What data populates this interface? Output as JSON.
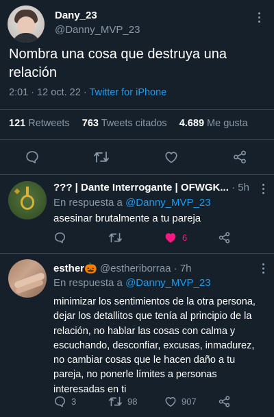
{
  "main_tweet": {
    "display_name": "Dany_23",
    "handle": "@Danny_MVP_23",
    "text": "Nombra una cosa que destruya una relación",
    "time": "2:01 · 12 oct. 22 · ",
    "source": "Twitter for iPhone",
    "stats": {
      "retweets_count": "121",
      "retweets_label": "Retweets",
      "quotes_count": "763",
      "quotes_label": "Tweets citados",
      "likes_count": "4.689",
      "likes_label": "Me gusta"
    }
  },
  "replies": [
    {
      "display_name": "??? | Dante Interrogante | OFWGK...",
      "meta": "· 5h",
      "reply_to_label": "En respuesta a ",
      "reply_to_handle": "@Danny_MVP_23",
      "text": "asesinar brutalmente a tu pareja",
      "actions": {
        "replies": "",
        "retweets": "",
        "likes": "6"
      },
      "liked": true
    },
    {
      "display_name": "esther🎃",
      "meta": "@estheriborraa · 7h",
      "reply_to_label": "En respuesta a ",
      "reply_to_handle": "@Danny_MVP_23",
      "text_lines": [
        "minimizar los sentimientos de la otra persona,",
        "dejar los detallitos que tenía al principio de la",
        "relación, no hablar las cosas con calma y",
        "escuchando, desconfiar, excusas, inmadurez,",
        "no cambiar cosas que le hacen daño a tu",
        "pareja, no ponerle límites a personas",
        "interesadas en ti"
      ],
      "actions": {
        "replies": "3",
        "retweets": "98",
        "likes": "907"
      },
      "liked": false
    }
  ],
  "colors": {
    "background": "#15202b",
    "text": "#ffffff",
    "muted": "#8b98a5",
    "accent": "#1d9bf0",
    "like": "#f91880",
    "divider": "#38444d"
  },
  "icons": [
    "more-icon",
    "reply-icon",
    "retweet-icon",
    "like-icon",
    "share-icon"
  ]
}
